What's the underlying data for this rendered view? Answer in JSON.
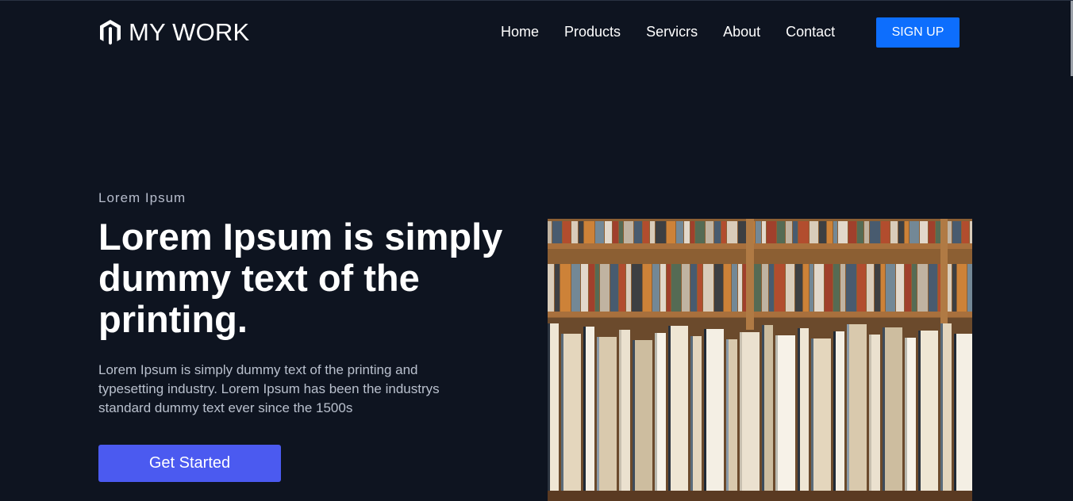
{
  "brand": {
    "name": "MY WORK",
    "icon": "magento-logo-icon"
  },
  "nav": {
    "items": [
      {
        "label": "Home"
      },
      {
        "label": "Products"
      },
      {
        "label": "Servicrs"
      },
      {
        "label": "About"
      },
      {
        "label": "Contact"
      }
    ],
    "signup_label": "SIGN UP"
  },
  "hero": {
    "eyebrow": "Lorem Ipsum",
    "headline": "Lorem Ipsum is simply dummy text of the printing.",
    "body": "Lorem Ipsum is simply dummy text of the printing and typesetting industry. Lorem Ipsum has been the industrys standard dummy text ever since the 1500s",
    "cta_label": "Get Started",
    "image": "bookshelf-photo"
  },
  "colors": {
    "background": "#0e1420",
    "signup_button": "#0d6efd",
    "cta_button": "#4b5af0",
    "body_text": "#b9c0cd"
  }
}
